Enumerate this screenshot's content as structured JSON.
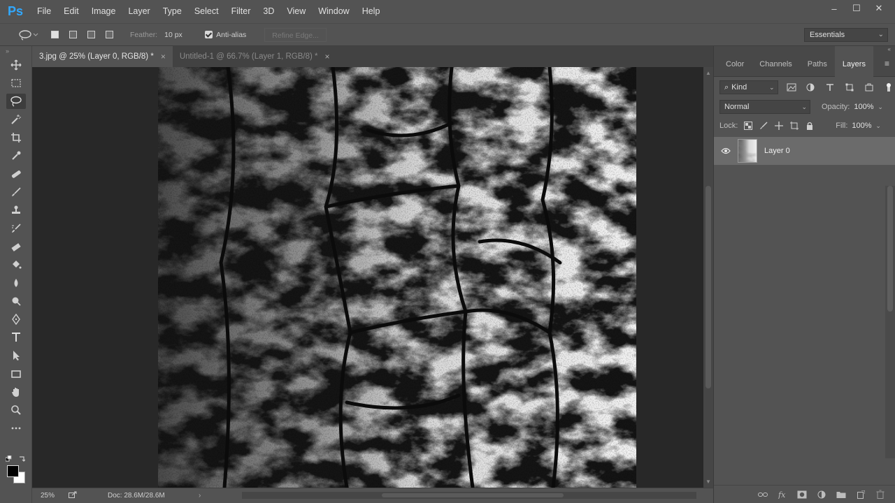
{
  "app": {
    "logo": "Ps"
  },
  "menu": [
    "File",
    "Edit",
    "Image",
    "Layer",
    "Type",
    "Select",
    "Filter",
    "3D",
    "View",
    "Window",
    "Help"
  ],
  "window_controls": {
    "minimize": "–",
    "maximize": "☐",
    "close": "✕"
  },
  "options": {
    "feather_label": "Feather:",
    "feather_value": "10 px",
    "antialias_label": "Anti-alias",
    "antialias_checked": true,
    "refine_edge_label": "Refine Edge...",
    "workspace": "Essentials"
  },
  "tabs": [
    {
      "label": "3.jpg @ 25% (Layer 0, RGB/8) *",
      "active": true
    },
    {
      "label": "Untitled-1 @ 66.7% (Layer 1, RGB/8) *",
      "active": false
    }
  ],
  "tools": [
    "move-tool-icon",
    "marquee-tool-icon",
    "lasso-tool-icon",
    "magic-wand-tool-icon",
    "crop-tool-icon",
    "eyedropper-tool-icon",
    "healing-brush-tool-icon",
    "brush-tool-icon",
    "clone-stamp-tool-icon",
    "history-brush-tool-icon",
    "eraser-tool-icon",
    "paint-bucket-tool-icon",
    "blur-tool-icon",
    "dodge-tool-icon",
    "pen-tool-icon",
    "type-tool-icon",
    "path-selection-tool-icon",
    "rectangle-tool-icon",
    "hand-tool-icon",
    "zoom-tool-icon",
    "more-tools-icon"
  ],
  "status": {
    "zoom": "25%",
    "doc_info": "Doc: 28.6M/28.6M"
  },
  "panel": {
    "tabs": [
      "Color",
      "Channels",
      "Paths",
      "Layers"
    ],
    "active_tab": "Layers",
    "filter_kind": "Kind",
    "blend_mode": "Normal",
    "opacity_label": "Opacity:",
    "opacity_value": "100%",
    "lock_label": "Lock:",
    "fill_label": "Fill:",
    "fill_value": "100%",
    "layers": [
      {
        "name": "Layer 0",
        "visible": true
      }
    ]
  },
  "colors": {
    "accent": "#31a8ff",
    "foreground": "#000000",
    "background": "#ffffff"
  }
}
